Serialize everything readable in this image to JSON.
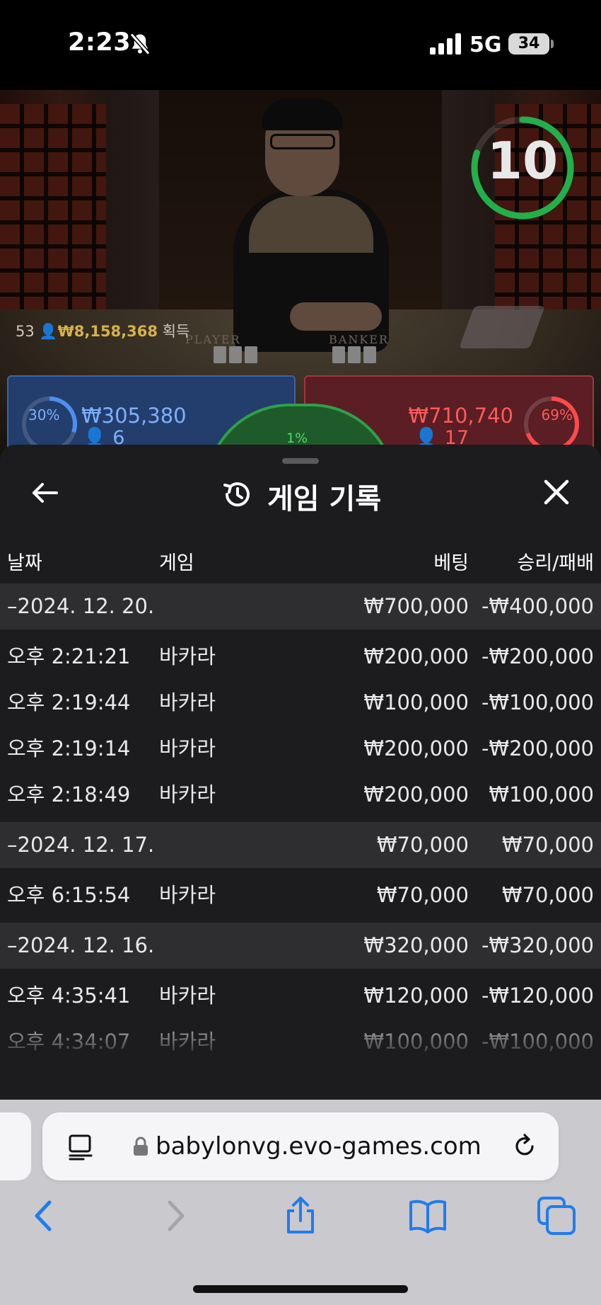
{
  "status_bar": {
    "time": "2:23",
    "network": "5G",
    "battery": "34"
  },
  "video": {
    "round_number": "53",
    "winnings": "₩8,158,368",
    "winnings_label": "획득",
    "player_label": "PLAYER",
    "banker_label": "BANKER",
    "timer": "10",
    "timer_fraction": 0.8
  },
  "bets": {
    "player": {
      "pct": "30%",
      "amount": "₩305,380",
      "count": "6"
    },
    "banker": {
      "pct": "69%",
      "amount": "₩710,740",
      "count": "17"
    },
    "tie": {
      "pct": "1%"
    }
  },
  "sheet": {
    "title": "게임 기록",
    "columns": {
      "date": "날짜",
      "game": "게임",
      "bet": "베팅",
      "win_loss": "승리/패배"
    },
    "groups": [
      {
        "date": "–2024. 12. 20.",
        "bet": "₩700,000",
        "result": "-₩400,000",
        "rows": [
          {
            "time": "오후 2:21:21",
            "game": "바카라",
            "bet": "₩200,000",
            "result": "-₩200,000"
          },
          {
            "time": "오후 2:19:44",
            "game": "바카라",
            "bet": "₩100,000",
            "result": "-₩100,000"
          },
          {
            "time": "오후 2:19:14",
            "game": "바카라",
            "bet": "₩200,000",
            "result": "-₩200,000"
          },
          {
            "time": "오후 2:18:49",
            "game": "바카라",
            "bet": "₩200,000",
            "result": "₩100,000"
          }
        ]
      },
      {
        "date": "–2024. 12. 17.",
        "bet": "₩70,000",
        "result": "₩70,000",
        "rows": [
          {
            "time": "오후 6:15:54",
            "game": "바카라",
            "bet": "₩70,000",
            "result": "₩70,000"
          }
        ]
      },
      {
        "date": "–2024. 12. 16.",
        "bet": "₩320,000",
        "result": "-₩320,000",
        "rows": [
          {
            "time": "오후 4:35:41",
            "game": "바카라",
            "bet": "₩120,000",
            "result": "-₩120,000"
          },
          {
            "time": "오후 4:34:07",
            "game": "바카라",
            "bet": "₩100,000",
            "result": "-₩100,000"
          }
        ]
      }
    ]
  },
  "browser": {
    "url": "babylonvg.evo-games.com"
  },
  "colors": {
    "sheet_bg": "#1c1c1e",
    "date_row_bg": "#2e2e31",
    "player_blue": "#233d6d",
    "banker_red": "#5a1e24",
    "timer_green": "#22b04b"
  }
}
